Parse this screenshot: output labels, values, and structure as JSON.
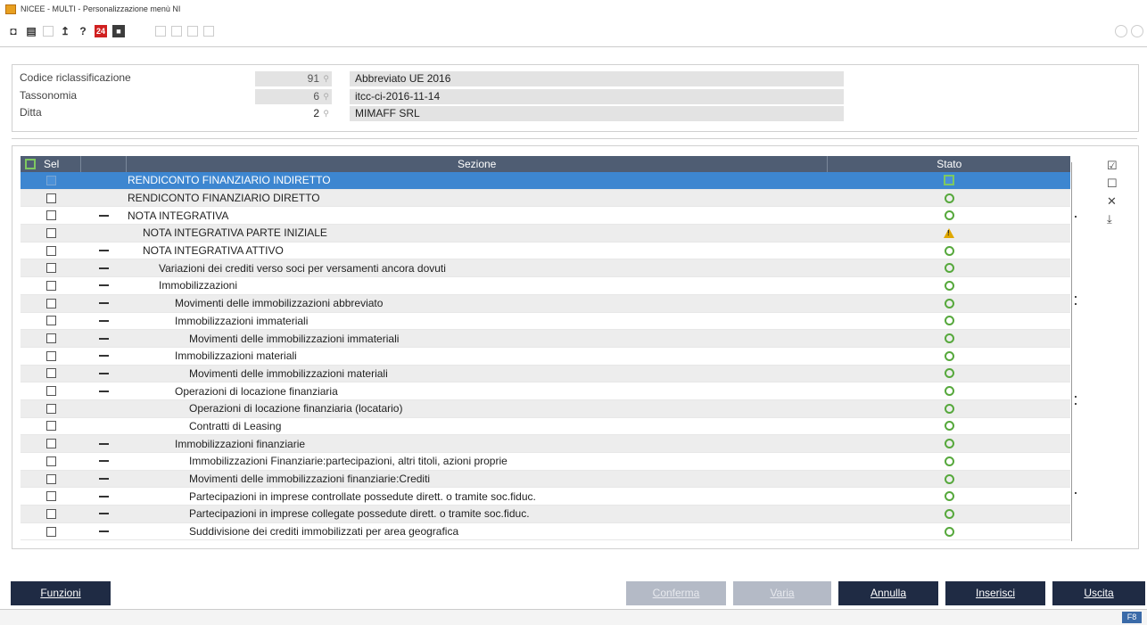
{
  "window": {
    "title": "NICEE - MULTI - Personalizzazione menù NI"
  },
  "toolbar": {
    "calendar_badge": "24",
    "help": "?",
    "upload": "↥"
  },
  "header": {
    "fields": [
      {
        "label": "Codice riclassificazione",
        "code": "91",
        "desc": "Abbreviato UE 2016"
      },
      {
        "label": "Tassonomia",
        "code": "6",
        "desc": "itcc-ci-2016-11-14"
      },
      {
        "label": "Ditta",
        "code": "2",
        "desc": "MIMAFF SRL"
      }
    ]
  },
  "grid": {
    "columns": {
      "sel": "Sel",
      "sezione": "Sezione",
      "stato": "Stato"
    },
    "rows": [
      {
        "sezione": "RENDICONTO FINANZIARIO INDIRETTO",
        "indent": 0,
        "dash": false,
        "status": "selected"
      },
      {
        "sezione": "RENDICONTO FINANZIARIO DIRETTO",
        "indent": 0,
        "dash": false,
        "status": "ok"
      },
      {
        "sezione": "NOTA INTEGRATIVA",
        "indent": 0,
        "dash": true,
        "status": "ok"
      },
      {
        "sezione": "NOTA INTEGRATIVA PARTE INIZIALE",
        "indent": 1,
        "dash": false,
        "status": "warning"
      },
      {
        "sezione": "NOTA INTEGRATIVA ATTIVO",
        "indent": 1,
        "dash": true,
        "status": "ok"
      },
      {
        "sezione": "Variazioni dei crediti verso soci per versamenti ancora dovuti",
        "indent": 2,
        "dash": true,
        "status": "ok"
      },
      {
        "sezione": "Immobilizzazioni",
        "indent": 2,
        "dash": true,
        "status": "ok"
      },
      {
        "sezione": "Movimenti delle immobilizzazioni abbreviato",
        "indent": 3,
        "dash": true,
        "status": "ok"
      },
      {
        "sezione": "Immobilizzazioni immateriali",
        "indent": 3,
        "dash": true,
        "status": "ok"
      },
      {
        "sezione": "Movimenti delle immobilizzazioni immateriali",
        "indent": 4,
        "dash": true,
        "status": "ok"
      },
      {
        "sezione": "Immobilizzazioni materiali",
        "indent": 3,
        "dash": true,
        "status": "ok"
      },
      {
        "sezione": "Movimenti delle immobilizzazioni materiali",
        "indent": 4,
        "dash": true,
        "status": "ok"
      },
      {
        "sezione": "Operazioni di locazione finanziaria",
        "indent": 3,
        "dash": true,
        "status": "ok"
      },
      {
        "sezione": "Operazioni di locazione finanziaria (locatario)",
        "indent": 4,
        "dash": false,
        "status": "ok"
      },
      {
        "sezione": "Contratti di Leasing",
        "indent": 4,
        "dash": false,
        "status": "ok"
      },
      {
        "sezione": "Immobilizzazioni finanziarie",
        "indent": 3,
        "dash": true,
        "status": "ok"
      },
      {
        "sezione": "Immobilizzazioni Finanziarie:partecipazioni, altri titoli, azioni proprie",
        "indent": 4,
        "dash": true,
        "status": "ok"
      },
      {
        "sezione": "Movimenti delle immobilizzazioni finanziarie:Crediti",
        "indent": 4,
        "dash": true,
        "status": "ok"
      },
      {
        "sezione": "Partecipazioni in imprese controllate possedute dirett. o tramite soc.fiduc.",
        "indent": 4,
        "dash": true,
        "status": "ok"
      },
      {
        "sezione": "Partecipazioni in imprese collegate possedute dirett. o tramite soc.fiduc.",
        "indent": 4,
        "dash": true,
        "status": "ok"
      },
      {
        "sezione": "Suddivisione dei crediti immobilizzati per area geografica",
        "indent": 4,
        "dash": true,
        "status": "ok"
      }
    ]
  },
  "buttons": {
    "funzioni": "Funzioni",
    "conferma": "Conferma",
    "varia": "Varia",
    "annulla": "Annulla",
    "inserisci": "Inserisci",
    "uscita": "Uscita"
  },
  "status_bar": {
    "badge": "F8"
  },
  "colors": {
    "header": "#4f5d73",
    "selected_row": "#3d86d0",
    "button": "#1f2b44",
    "ok": "#56a83c",
    "warning": "#e0a800"
  }
}
